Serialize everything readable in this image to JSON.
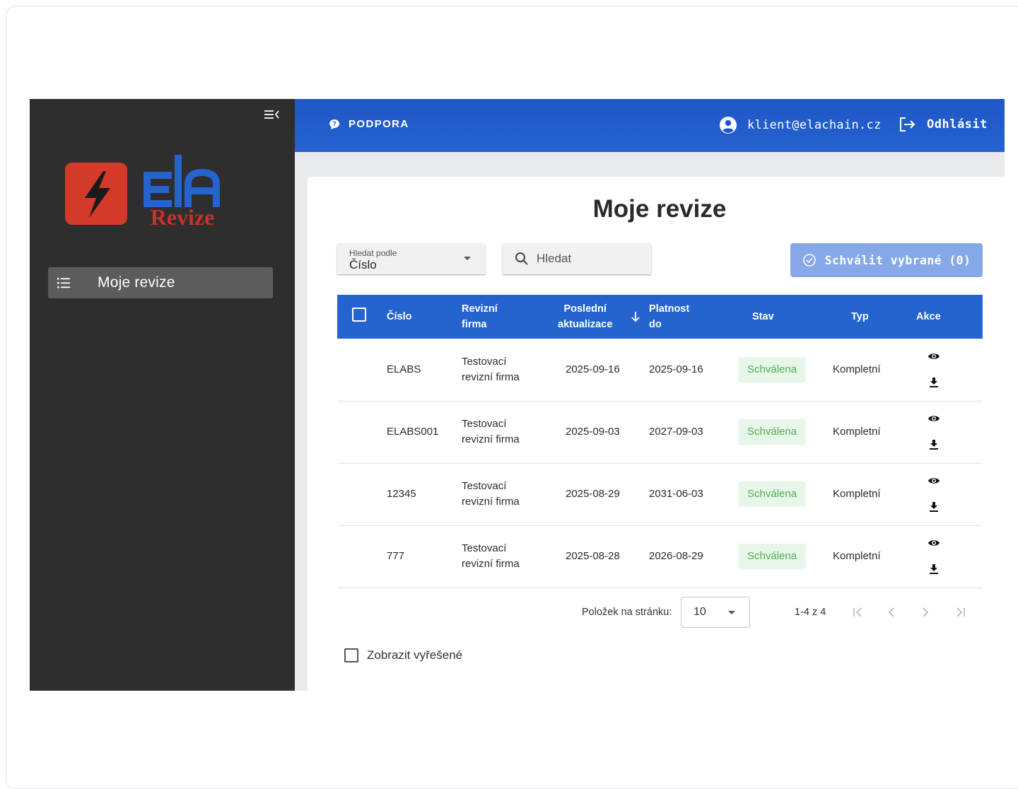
{
  "sidebar": {
    "logo_text": "ElA",
    "logo_subtext": "Revize",
    "nav_items": [
      {
        "label": "Moje revize",
        "icon": "list-icon"
      }
    ]
  },
  "topbar": {
    "support_label": "PODPORA",
    "user_email": "klient@elachain.cz",
    "logout_label": "Odhlásit"
  },
  "page": {
    "title": "Moje revize",
    "search_by_label": "Hledat podle",
    "search_by_value": "Číslo",
    "search_placeholder": "Hledat",
    "approve_label": "Schválit vybrané (0)"
  },
  "table": {
    "headers": {
      "number": "Číslo",
      "firm_1": "Revizní",
      "firm_2": "firma",
      "updated_1": "Poslední",
      "updated_2": "aktualizace",
      "valid_1": "Platnost",
      "valid_2": "do",
      "status": "Stav",
      "type": "Typ",
      "actions": "Akce"
    },
    "rows": [
      {
        "number": "ELABS",
        "firm_1": "Testovací",
        "firm_2": "revizní firma",
        "updated": "2025-09-16",
        "valid": "2025-09-16",
        "status": "Schválena",
        "type": "Kompletní"
      },
      {
        "number": "ELABS001",
        "firm_1": "Testovací",
        "firm_2": "revizní firma",
        "updated": "2025-09-03",
        "valid": "2027-09-03",
        "status": "Schválena",
        "type": "Kompletní"
      },
      {
        "number": "12345",
        "firm_1": "Testovací",
        "firm_2": "revizní firma",
        "updated": "2025-08-29",
        "valid": "2031-06-03",
        "status": "Schválena",
        "type": "Kompletní"
      },
      {
        "number": "777",
        "firm_1": "Testovací",
        "firm_2": "revizní firma",
        "updated": "2025-08-28",
        "valid": "2026-08-29",
        "status": "Schválena",
        "type": "Kompletní"
      }
    ]
  },
  "pagination": {
    "per_page_label": "Položek na stránku:",
    "per_page_value": "10",
    "range": "1-4 z 4"
  },
  "show_resolved_label": "Zobrazit vyřešené",
  "colors": {
    "primary": "#2563cf",
    "sidebar_bg": "#2e2e2e",
    "approve_disabled": "#86a8e6",
    "status_green": "#4caf50",
    "logo_red": "#d33a2a",
    "logo_blue": "#2563cf"
  }
}
